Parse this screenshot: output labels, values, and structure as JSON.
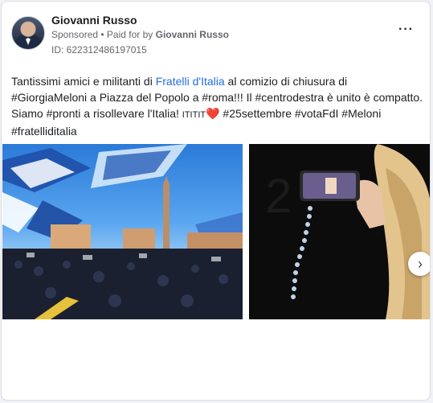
{
  "post": {
    "author": "Giovanni Russo",
    "sponsored_label": "Sponsored",
    "paid_for_prefix": " • Paid for by ",
    "paid_for_name": "Giovanni Russo",
    "id_label": "ID: 622312486197015",
    "more_icon": "···",
    "text": {
      "part1": "Tantissimi amici e militanti di ",
      "link": "Fratelli d'Italia",
      "part2": " al comizio di chiusura di #GiorgiaMeloni a Piazza del Popolo a #roma!!! Il #centrodestra è unito è compatto. Siamo #pronti a risollevare l'Italia! ",
      "flags": "ITITIT",
      "heart": "❤️",
      "part3": " #25settembre #votaFdI #Meloni #fratelliditalia"
    },
    "next_icon": "›"
  },
  "colors": {
    "link": "#216fdb",
    "heart": "#e0245e"
  }
}
